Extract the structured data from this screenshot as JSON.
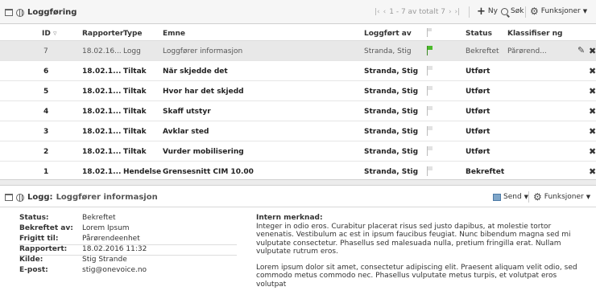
{
  "list_panel": {
    "title": "Loggføring",
    "pager_text": "1 - 7 av totalt 7",
    "new_label": "Ny",
    "search_label": "Søk",
    "functions_label": "Funksjoner"
  },
  "columns": {
    "id": "ID",
    "reported": "Rapporter",
    "type": "Type",
    "subject": "Emne",
    "logged_by": "Loggført av",
    "status": "Status",
    "classification": "Klassifiser ng"
  },
  "rows": [
    {
      "id": "7",
      "date": "18.02.16...",
      "type": "Logg",
      "subject": "Loggfører informasjon",
      "logged_by": "Stranda, Stig",
      "status": "Bekreftet",
      "classification": "Pårørend...",
      "selected": true,
      "flag": "green",
      "bold": false
    },
    {
      "id": "6",
      "date": "18.02.1...",
      "type": "Tiltak",
      "subject": "Når skjedde det",
      "logged_by": "Stranda, Stig",
      "status": "Utført",
      "classification": "",
      "selected": false,
      "flag": "grey",
      "bold": true
    },
    {
      "id": "5",
      "date": "18.02.1...",
      "type": "Tiltak",
      "subject": "Hvor har det skjedd",
      "logged_by": "Stranda, Stig",
      "status": "Utført",
      "classification": "",
      "selected": false,
      "flag": "grey",
      "bold": true
    },
    {
      "id": "4",
      "date": "18.02.1...",
      "type": "Tiltak",
      "subject": "Skaff utstyr",
      "logged_by": "Stranda, Stig",
      "status": "Utført",
      "classification": "",
      "selected": false,
      "flag": "grey",
      "bold": true
    },
    {
      "id": "3",
      "date": "18.02.1...",
      "type": "Tiltak",
      "subject": "Avklar sted",
      "logged_by": "Stranda, Stig",
      "status": "Utført",
      "classification": "",
      "selected": false,
      "flag": "grey",
      "bold": true
    },
    {
      "id": "2",
      "date": "18.02.1...",
      "type": "Tiltak",
      "subject": "Vurder mobilisering",
      "logged_by": "Stranda, Stig",
      "status": "Utført",
      "classification": "",
      "selected": false,
      "flag": "grey",
      "bold": true
    },
    {
      "id": "1",
      "date": "18.02.1...",
      "type": "Hendelse",
      "subject": "Grensesnitt CIM 10.00",
      "logged_by": "Stranda, Stig",
      "status": "Bekreftet",
      "classification": "",
      "selected": false,
      "flag": "grey",
      "bold": true
    }
  ],
  "detail": {
    "title": "Logg:",
    "subtitle": "Loggfører informasjon",
    "send_label": "Send",
    "functions_label": "Funksjoner",
    "properties": [
      {
        "key": "Status:",
        "value": "Bekreftet"
      },
      {
        "key": "Bekreftet av:",
        "value": "Lorem Ipsum"
      },
      {
        "key": "Frigitt til:",
        "value": "Pårørendeenhet"
      },
      {
        "key": "Rapportert:",
        "value": "18.02.2016 11:32"
      },
      {
        "key": "Kilde:",
        "value": "Stig Strande"
      },
      {
        "key": "E-post:",
        "value": "stig@onevoice.no"
      }
    ],
    "note_title": "Intern merknad:",
    "note_p1": "Integer in odio eros. Curabitur placerat risus sed justo dapibus, at molestie tortor venenatis. Vestibulum ac est in ipsum faucibus feugiat. Nunc bibendum magna sed mi vulputate consectetur. Phasellus sed malesuada nulla, pretium fringilla erat. Nullam vulputate rutrum eros.",
    "note_p2": "Lorem ipsum dolor sit amet, consectetur adipiscing elit. Praesent aliquam velit odio, sed commodo metus commodo nec. Phasellus vulputate metus turpis, et volutpat eros volutpat"
  },
  "colors": {
    "flag_green": "#4cba2c",
    "selected_row": "#e8e8e8"
  }
}
